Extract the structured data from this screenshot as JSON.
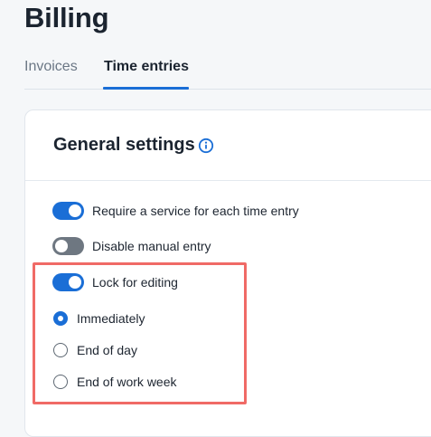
{
  "page": {
    "title": "Billing"
  },
  "tabs": [
    {
      "label": "Invoices",
      "active": false
    },
    {
      "label": "Time entries",
      "active": true
    }
  ],
  "general_settings": {
    "title": "General settings",
    "info_icon": "info-circle-icon",
    "toggles": [
      {
        "label": "Require a service for each time entry",
        "on": true
      },
      {
        "label": "Disable manual entry",
        "on": false
      },
      {
        "label": "Lock for editing",
        "on": true
      }
    ],
    "lock_options": [
      {
        "label": "Immediately",
        "selected": true
      },
      {
        "label": "End of day",
        "selected": false
      },
      {
        "label": "End of work week",
        "selected": false
      }
    ]
  },
  "colors": {
    "accent": "#1a6ed6",
    "toggle_off": "#6e7781",
    "highlight": "#f06a66"
  }
}
